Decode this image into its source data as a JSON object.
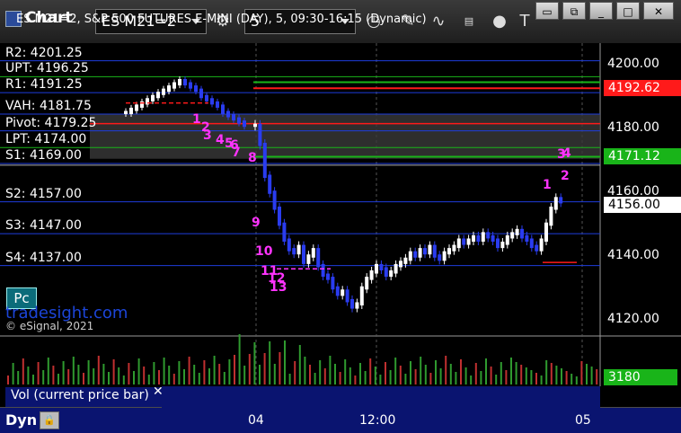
{
  "app": {
    "title": "Chart"
  },
  "toolbar": {
    "symbol": "ES M21=2",
    "interval": "5"
  },
  "chart": {
    "header": "ES M21=2, S&P 500 FUTURES E-MINI (DAY), 5, 09:30-16:15 (Dynamic)",
    "levels": [
      {
        "label": "R2: 4201.25",
        "price": 4201.25
      },
      {
        "label": "UPT: 4196.25",
        "price": 4196.25
      },
      {
        "label": "R1: 4191.25",
        "price": 4191.25
      },
      {
        "label": "VAH: 4181.75",
        "price": 4184.5
      },
      {
        "label": "Pivot: 4179.25",
        "price": 4179.25
      },
      {
        "label": "LPT: 4174.00",
        "price": 4174.0
      },
      {
        "label": "S1: 4169.00",
        "price": 4169.0
      },
      {
        "label": "S2: 4157.00",
        "price": 4157.0
      },
      {
        "label": "S3: 4147.00",
        "price": 4147.0
      },
      {
        "label": "S4: 4137.00",
        "price": 4137.0
      }
    ],
    "price_ticks": [
      "4200.00",
      "4180.00",
      "4160.00",
      "4140.00",
      "4120.00"
    ],
    "tag_red": "4192.62",
    "tag_green": "4171.12",
    "tag_last": "4156.00",
    "vol_tag": "3180",
    "time_ticks": [
      "04",
      "12:00",
      "05"
    ],
    "pc_label": "Pc",
    "brand": "tradesight.com",
    "copyright": "© eSignal, 2021",
    "count_labels": [
      "1",
      "2",
      "3",
      "4",
      "5",
      "6",
      "7",
      "8",
      "9",
      "10",
      "11",
      "12",
      "13",
      "1",
      "2",
      "3",
      "4"
    ]
  },
  "volume": {
    "label": "Vol (current price bar)"
  },
  "status": {
    "mode": "Dyn"
  },
  "colors": {
    "bg": "#000000",
    "up": "#ffffff",
    "down": "#2a3cf0",
    "level": "#1e3cdc",
    "count": "#ff33ff",
    "red": "#ff1a1a",
    "green": "#19b419"
  }
}
